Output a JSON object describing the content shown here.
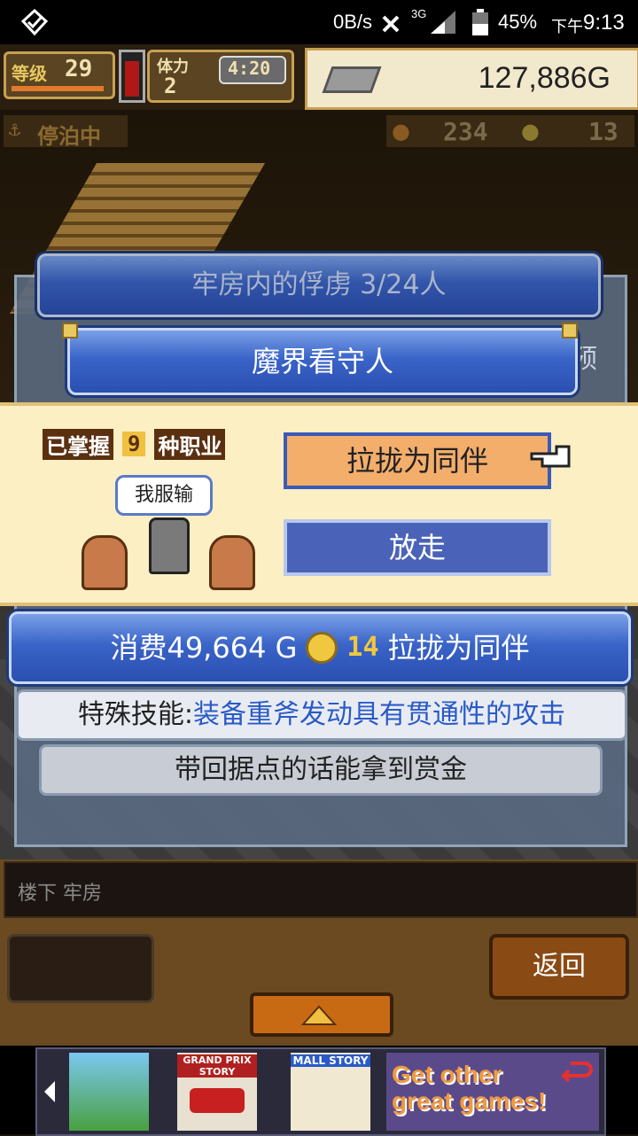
{
  "status_bar": {
    "network_speed": "0B/s",
    "network_type": "3G",
    "battery": "45%",
    "time_prefix": "下午",
    "time": "9:13",
    "icons": [
      "app-notify-icon",
      "sim-x-icon",
      "signal-icon",
      "battery-icon"
    ]
  },
  "hud": {
    "level_label": "等级",
    "level": "29",
    "stamina_label": "体力",
    "stamina": "2",
    "timer": "4:20",
    "gold": "127,886G",
    "status": "停泊中",
    "food_count": "234",
    "coin_count": "13"
  },
  "dialog": {
    "header": "牢房内的俘虏 3/24人",
    "name": "魔界看守人",
    "mastered_prefix": "已掌握",
    "mastered_count": "9",
    "mastered_suffix": "种职业",
    "speech": "我服输",
    "recruit_button": "拉拢为同伴",
    "release_button": "放走",
    "cost_prefix": "消费49,664 G",
    "cost_medals": "14",
    "cost_suffix": "拉拢为同伴",
    "skill_label": "特殊技能:",
    "skill_text": "装备重斧发动具有贯通性的攻击",
    "bounty_text": "带回据点的话能拿到赏金",
    "side_peek_text": "预"
  },
  "footer": {
    "location": "楼下 牢房",
    "back_button": "返回"
  },
  "ad": {
    "game1_title": "GRAND PRIX STORY",
    "game2_title": "MALL STORY",
    "cta": "Get other great games!"
  },
  "colors": {
    "accent_orange": "#f3ae6c",
    "bar_blue": "#3a64c8",
    "cream": "#fbefc3",
    "gold": "#e8c860"
  }
}
